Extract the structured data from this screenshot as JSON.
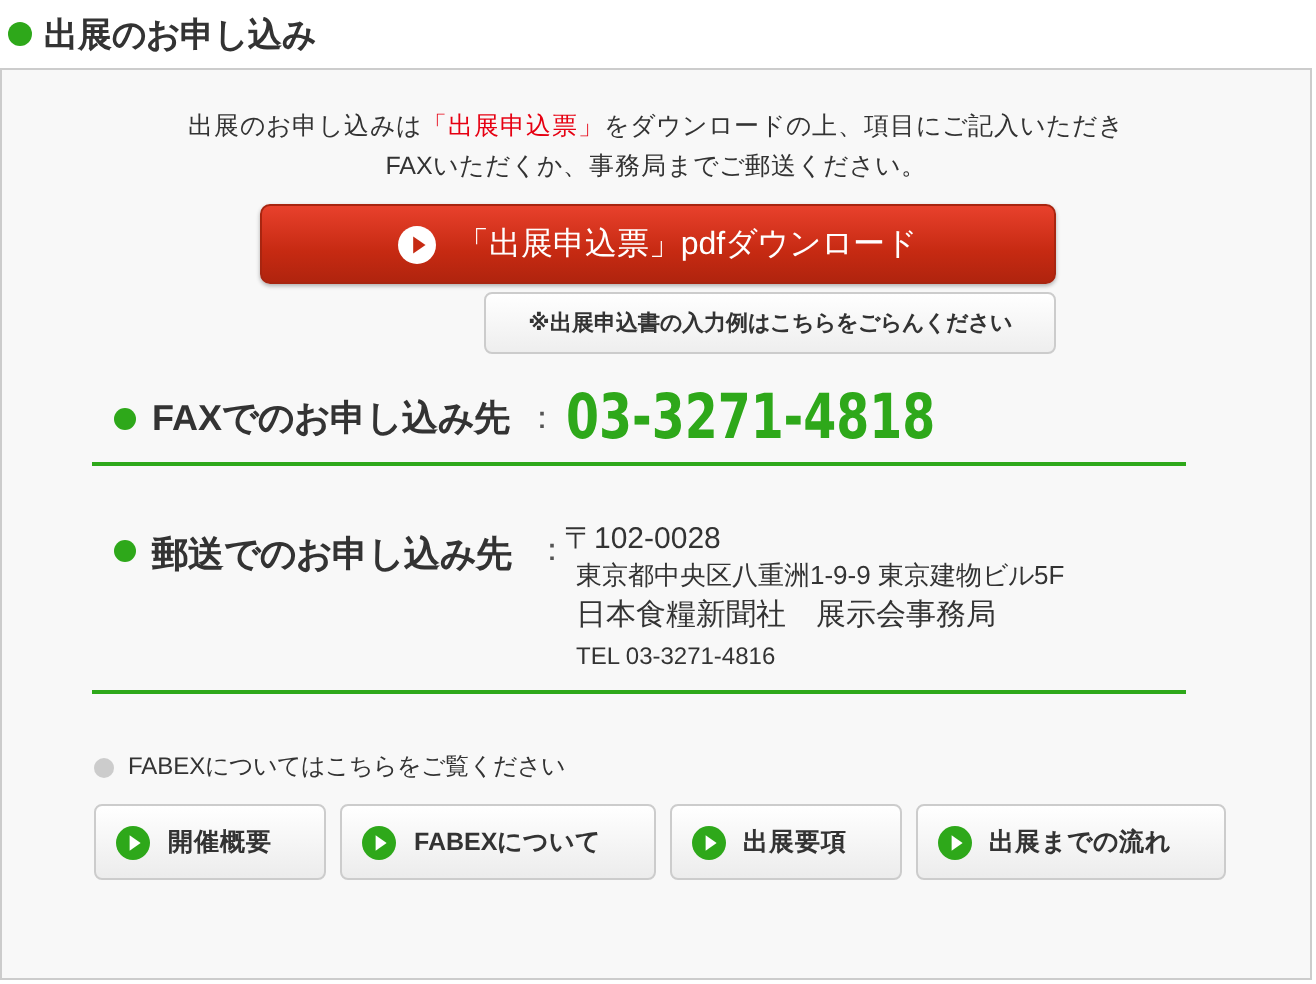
{
  "heading": "出展のお申し込み",
  "intro": [
    {
      "text": "出展のお申し込みは",
      "highlight": false
    },
    {
      "text": "「出展申込票」",
      "highlight": true
    },
    {
      "text": "をダウンロードの上、項目にご記入いただき",
      "highlight": false
    },
    {
      "text": "FAXいただくか、事務局までご郵送ください。",
      "highlight": false,
      "break_before": true
    }
  ],
  "download_button": "「出展申込票」pdfダウンロード",
  "example_button": "※出展申込書の入力例はこちらをごらんください",
  "fax": {
    "label": "FAXでのお申し込み先",
    "separator": "：",
    "number": "03-3271-4818"
  },
  "post": {
    "label": "郵送でのお申し込み先",
    "separator": "：",
    "lines": [
      {
        "text": "〒102-0028",
        "kind": "normal"
      },
      {
        "text": "東京都中央区八重洲1-9-9 東京建物ビル5F",
        "kind": "normal"
      },
      {
        "text": "日本食糧新聞社　展示会事務局",
        "kind": "large"
      },
      {
        "text": "TEL 03-3271-4816",
        "kind": "small"
      }
    ]
  },
  "links_heading": "FABEXについてはこちらをご覧ください",
  "link_buttons": [
    "開催概要",
    "FABEXについて",
    "出展要項",
    "出展までの流れ"
  ]
}
